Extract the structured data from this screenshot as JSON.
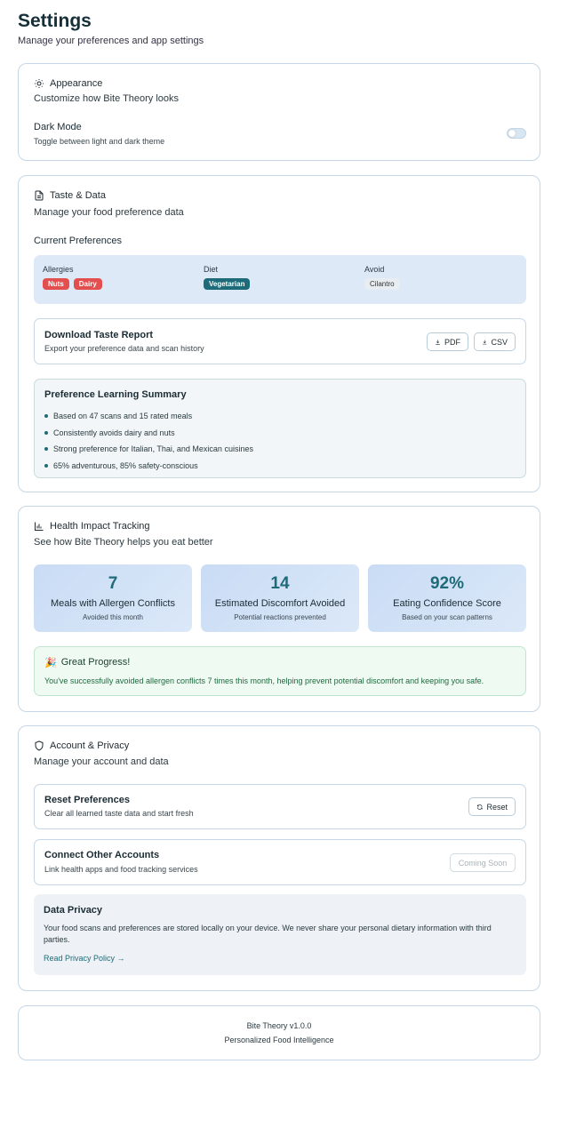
{
  "header": {
    "title": "Settings",
    "subtitle": "Manage your preferences and app settings"
  },
  "appearance": {
    "title": "Appearance",
    "description": "Customize how Bite Theory looks",
    "dark_mode_label": "Dark Mode",
    "dark_mode_description": "Toggle between light and dark theme",
    "dark_mode_on": false
  },
  "taste": {
    "title": "Taste & Data",
    "description": "Manage your food preference data",
    "current_prefs_title": "Current Preferences",
    "allergies_label": "Allergies",
    "allergies": [
      "Nuts",
      "Dairy"
    ],
    "diet_label": "Diet",
    "diet": [
      "Vegetarian"
    ],
    "avoid_label": "Avoid",
    "avoid": [
      "Cilantro"
    ],
    "report_title": "Download Taste Report",
    "report_description": "Export your preference data and scan history",
    "pdf_label": "PDF",
    "csv_label": "CSV",
    "summary_title": "Preference Learning Summary",
    "summary_items": [
      "Based on 47 scans and 15 rated meals",
      "Consistently avoids dairy and nuts",
      "Strong preference for Italian, Thai, and Mexican cuisines",
      "65% adventurous, 85% safety-conscious"
    ]
  },
  "health": {
    "title": "Health Impact Tracking",
    "description": "See how Bite Theory helps you eat better",
    "stats": [
      {
        "value": "7",
        "label": "Meals with Allergen Conflicts",
        "sub": "Avoided this month"
      },
      {
        "value": "14",
        "label": "Estimated Discomfort Avoided",
        "sub": "Potential reactions prevented"
      },
      {
        "value": "92%",
        "label": "Eating Confidence Score",
        "sub": "Based on your scan patterns"
      }
    ],
    "progress_emoji": "🎉",
    "progress_title": "Great Progress!",
    "progress_text": "You've successfully avoided allergen conflicts 7 times this month, helping prevent potential discomfort and keeping you safe."
  },
  "account": {
    "title": "Account & Privacy",
    "description": "Manage your account and data",
    "reset_title": "Reset Preferences",
    "reset_description": "Clear all learned taste data and start fresh",
    "reset_label": "Reset",
    "connect_title": "Connect Other Accounts",
    "connect_description": "Link health apps and food tracking services",
    "connect_label": "Coming Soon",
    "privacy_title": "Data Privacy",
    "privacy_text": "Your food scans and preferences are stored locally on your device. We never share your personal dietary information with third parties.",
    "privacy_link": "Read Privacy Policy →"
  },
  "footer": {
    "version": "Bite Theory v1.0.0",
    "tagline": "Personalized Food Intelligence"
  },
  "colors": {
    "accent": "#1d6b78",
    "allergy_tag": "#e34f4f",
    "border": "#c5d7e6"
  }
}
